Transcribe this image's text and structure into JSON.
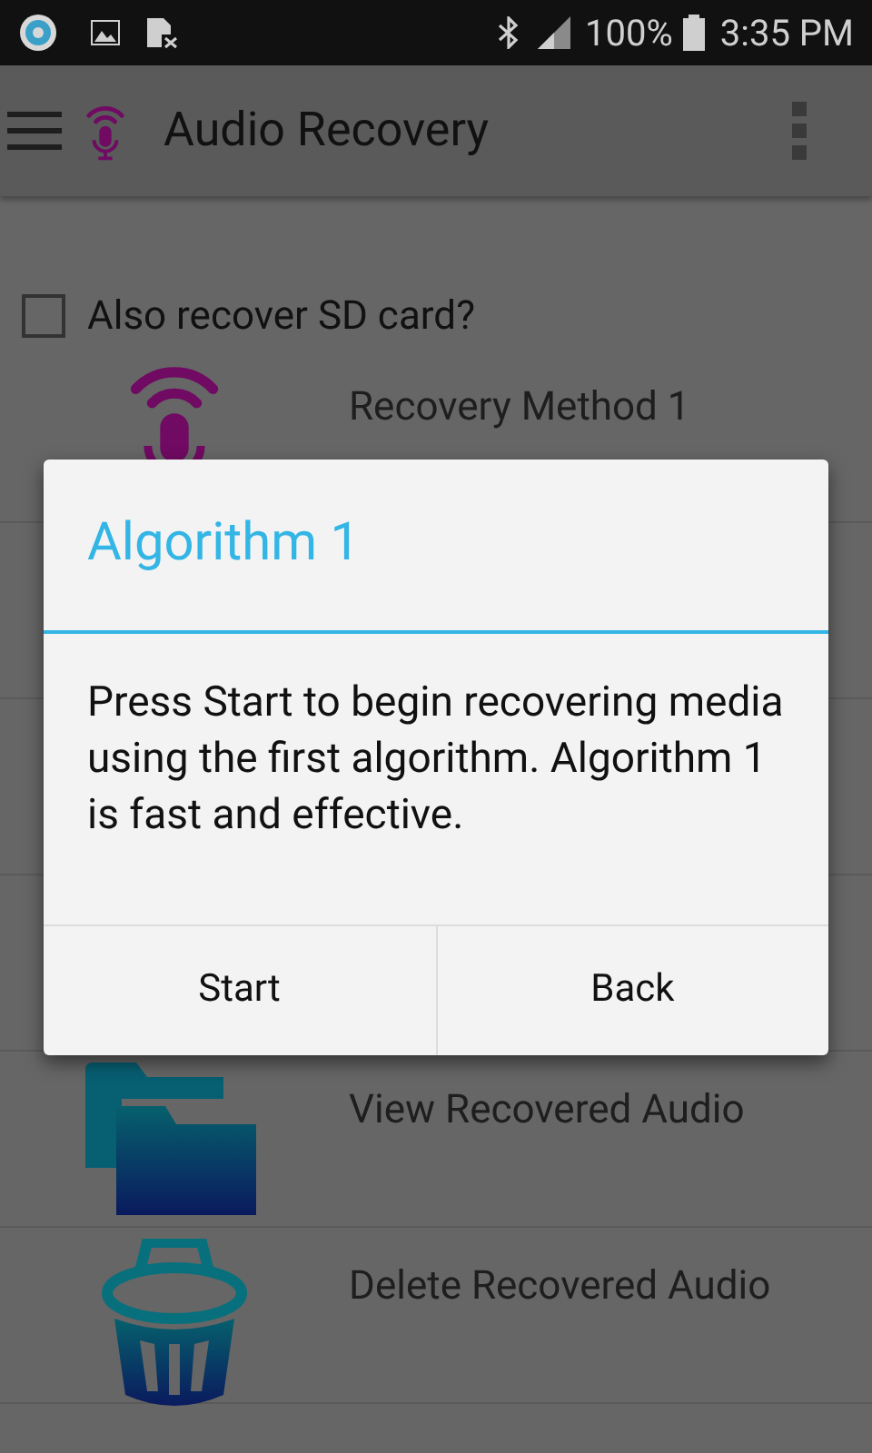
{
  "status_bar": {
    "battery": "100%",
    "time": "3:35 PM"
  },
  "app_bar": {
    "title": "Audio Recovery"
  },
  "sd_option": {
    "label": "Also recover SD card?",
    "checked": false
  },
  "menu": [
    {
      "kind": "mic",
      "label": "Recovery Method 1"
    },
    {
      "kind": "hidden"
    },
    {
      "kind": "hidden"
    },
    {
      "kind": "hidden"
    },
    {
      "kind": "folder",
      "label": "View Recovered Audio"
    },
    {
      "kind": "trash",
      "label": "Delete Recovered Audio"
    }
  ],
  "dialog": {
    "title": "Algorithm 1",
    "message": "Press Start to begin recovering media using the first algorithm. Algorithm 1 is fast and effective.",
    "buttons": [
      "Start",
      "Back"
    ]
  }
}
